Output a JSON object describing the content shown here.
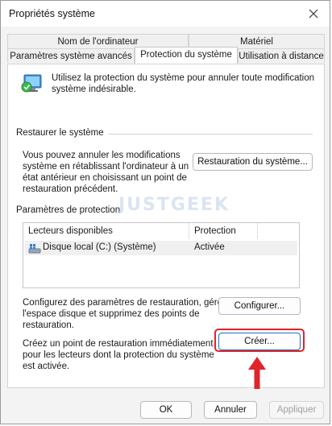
{
  "window": {
    "title": "Propriétés système"
  },
  "tabs": {
    "row1": [
      "Nom de l'ordinateur",
      "Matériel"
    ],
    "row2": [
      "Paramètres système avancés",
      "Protection du système",
      "Utilisation à distance"
    ]
  },
  "intro": {
    "line1": "Utilisez la protection du système pour annuler toute modification",
    "line2": "système indésirable."
  },
  "restore": {
    "section": "Restaurer le système",
    "desc": [
      "Vous pouvez annuler les modifications",
      "système en rétablissant l'ordinateur à un",
      "état antérieur en choisissant un point de",
      "restauration précédent."
    ],
    "button": "Restauration du système..."
  },
  "protection": {
    "section": "Paramètres de protection",
    "columns": [
      "Lecteurs disponibles",
      "Protection"
    ],
    "rows": [
      {
        "drive": "Disque local (C:) (Système)",
        "status": "Activée"
      }
    ]
  },
  "configure": {
    "desc": [
      "Configurez des paramètres de restauration, gérez",
      "l'espace disque et supprimez des points de",
      "restauration."
    ],
    "button": "Configurer..."
  },
  "create": {
    "desc": [
      "Créez un point de restauration immédiatement",
      "pour les lecteurs dont la protection du système",
      "est activée."
    ],
    "button": "Créer..."
  },
  "footer": {
    "ok": "OK",
    "cancel": "Annuler",
    "apply": "Appliquer"
  },
  "watermark": "JUSTGEEK",
  "colors": {
    "highlight": "#e0242a",
    "arrow": "#e0242a",
    "focus": "#1b6fc4"
  },
  "icons": [
    "close-icon",
    "system-protection-icon",
    "drive-icon",
    "arrow-up-icon"
  ]
}
